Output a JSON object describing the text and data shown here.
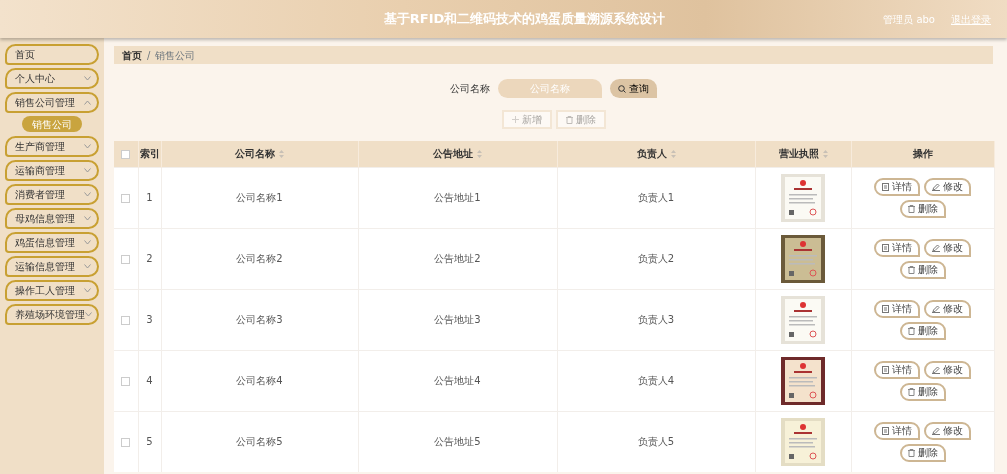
{
  "header": {
    "title": "基于RFID和二维码技术的鸡蛋质量溯源系统设计",
    "user": "管理员 abo",
    "logout": "退出登录"
  },
  "sidebar": {
    "items": [
      {
        "label": "首页",
        "kind": "link"
      },
      {
        "label": "个人中心",
        "kind": "group",
        "expanded": false
      },
      {
        "label": "销售公司管理",
        "kind": "group",
        "expanded": true,
        "children": [
          {
            "label": "销售公司",
            "selected": true
          }
        ]
      },
      {
        "label": "生产商管理",
        "kind": "group",
        "expanded": false
      },
      {
        "label": "运输商管理",
        "kind": "group",
        "expanded": false
      },
      {
        "label": "消费者管理",
        "kind": "group",
        "expanded": false
      },
      {
        "label": "母鸡信息管理",
        "kind": "group",
        "expanded": false
      },
      {
        "label": "鸡蛋信息管理",
        "kind": "group",
        "expanded": false
      },
      {
        "label": "运输信息管理",
        "kind": "group",
        "expanded": false
      },
      {
        "label": "操作工人管理",
        "kind": "group",
        "expanded": false
      },
      {
        "label": "养殖场环境管理",
        "kind": "group",
        "expanded": false
      }
    ]
  },
  "breadcrumb": {
    "items": [
      "首页",
      "销售公司"
    ],
    "separator": "/"
  },
  "search": {
    "label": "公司名称",
    "placeholder": "公司名称",
    "button": "查询"
  },
  "toolbar": [
    {
      "label": "新增",
      "kind": "add",
      "disabled": true
    },
    {
      "label": "删除",
      "kind": "delete",
      "disabled": true
    }
  ],
  "table": {
    "select_all_checked": false,
    "columns": [
      {
        "label": "索引",
        "sortable": false
      },
      {
        "label": "公司名称",
        "sortable": true
      },
      {
        "label": "公告地址",
        "sortable": true
      },
      {
        "label": "负责人",
        "sortable": true
      },
      {
        "label": "营业执照",
        "sortable": true
      },
      {
        "label": "操作",
        "sortable": false
      }
    ],
    "rows": [
      {
        "checked": false,
        "index": "1",
        "name": "公司名称1",
        "address": "公告地址1",
        "person": "负责人1",
        "actions": [
          "详情",
          "修改",
          "删除"
        ]
      },
      {
        "checked": false,
        "index": "2",
        "name": "公司名称2",
        "address": "公告地址2",
        "person": "负责人2",
        "actions": [
          "详情",
          "修改",
          "删除"
        ]
      },
      {
        "checked": false,
        "index": "3",
        "name": "公司名称3",
        "address": "公告地址3",
        "person": "负责人3",
        "actions": [
          "详情",
          "修改",
          "删除"
        ]
      },
      {
        "checked": false,
        "index": "4",
        "name": "公司名称4",
        "address": "公告地址4",
        "person": "负责人4",
        "actions": [
          "详情",
          "修改",
          "删除"
        ]
      },
      {
        "checked": false,
        "index": "5",
        "name": "公司名称5",
        "address": "公告地址5",
        "person": "负责人5",
        "actions": [
          "详情",
          "修改",
          "删除"
        ]
      }
    ]
  }
}
